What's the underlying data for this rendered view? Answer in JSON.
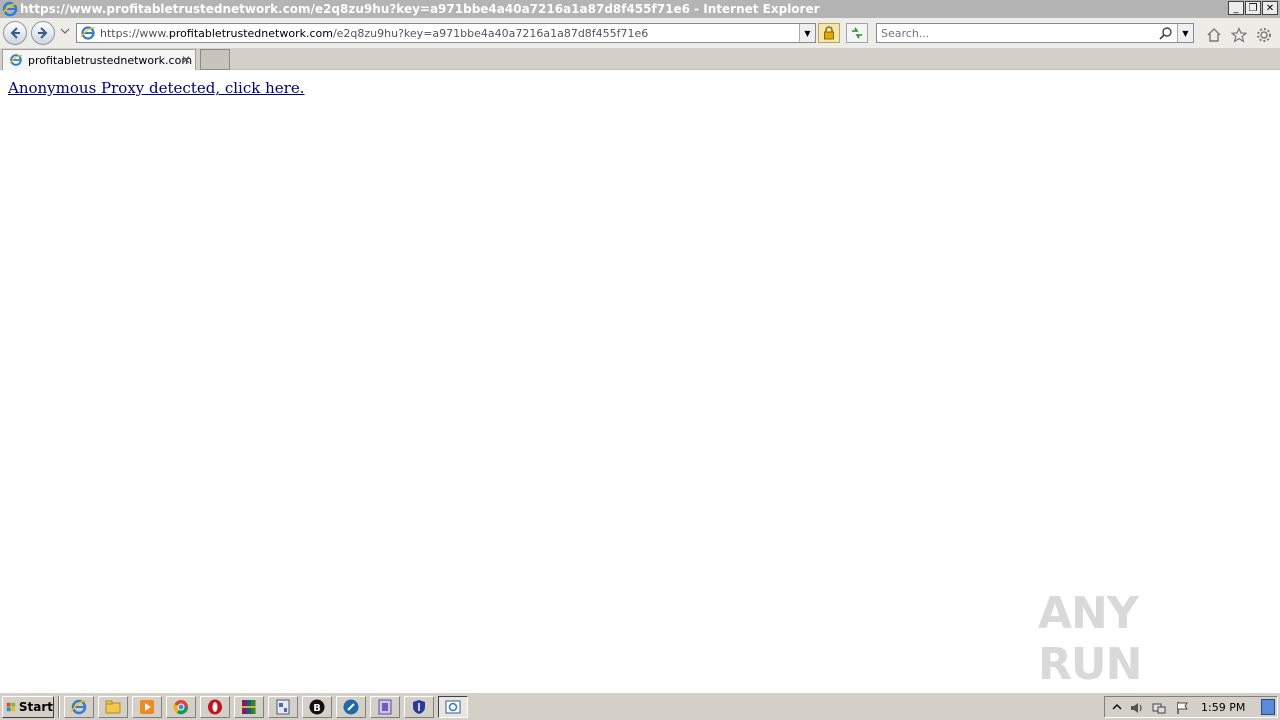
{
  "window": {
    "title": "https://www.profitabletrustednetwork.com/e2q8zu9hu?key=a971bbe4a40a7216a1a87d8f455f71e6 - Internet Explorer",
    "minimize": "_",
    "restore": "❐",
    "close": "✕"
  },
  "address_bar": {
    "prefix": "https://www.",
    "domain": "profitabletrustednetwork.com",
    "path": "/e2q8zu9hu?key=a971bbe4a40a7216a1a87d8f455f71e6"
  },
  "search": {
    "placeholder": "Search..."
  },
  "tabs": [
    {
      "label": "profitabletrustednetwork.com",
      "close": "✕"
    }
  ],
  "page": {
    "link_text": "Anonymous Proxy detected, click here."
  },
  "watermark": {
    "text": "ANY RUN"
  },
  "taskbar": {
    "start_label": "Start",
    "apps": [
      "internet-explorer-icon",
      "folder-icon",
      "media-player-icon",
      "chrome-icon",
      "opera-icon",
      "winrar-icon",
      "app-icon",
      "b-icon",
      "app-circle-icon",
      "app-doc-icon",
      "app-shield-icon",
      "ie-window-icon"
    ],
    "clock": "1:59 PM"
  },
  "colors": {
    "link": "#000080",
    "titlebar": "#b4b4b4",
    "taskbar": "#d4d0c8"
  }
}
